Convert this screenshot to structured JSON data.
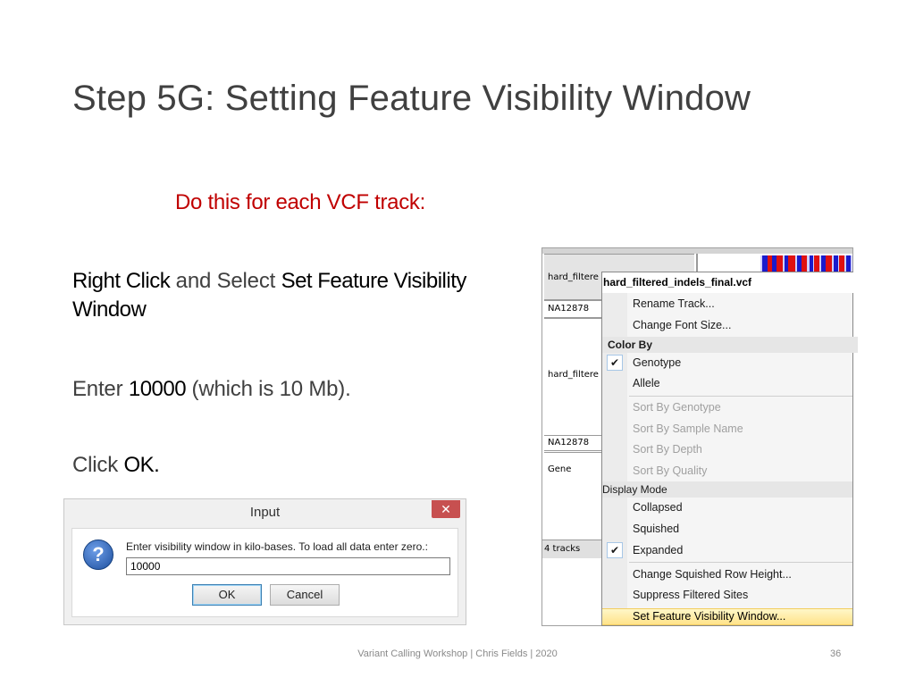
{
  "slide": {
    "title": "Step 5G: Setting Feature Visibility Window",
    "subtitle": "Do this for each VCF track:",
    "step1": {
      "em1": "Right Click",
      "mid": " and Select ",
      "em2": "Set Feature Visibility",
      "em3": "Window"
    },
    "step2": {
      "pre": "Enter ",
      "em": "10000",
      "post": " (which is 10 Mb)."
    },
    "step3": {
      "pre": "Click ",
      "em": "OK."
    },
    "footer": "Variant Calling Workshop | Chris Fields | 2020",
    "page_number": "36"
  },
  "dialog": {
    "title": "Input",
    "close": "✕",
    "icon": "question-icon",
    "prompt": "Enter visibility window in kilo-bases.  To load all data enter zero.:",
    "value": "10000",
    "ok_label": "OK",
    "cancel_label": "Cancel"
  },
  "igv": {
    "tracks": [
      "hard_filtere",
      "NA12878",
      "hard_filtere",
      "NA12878",
      "Gene",
      "4 tracks"
    ],
    "variant_colors": [
      "#1a1acc",
      "#e01010",
      "#ffffff"
    ]
  },
  "menu": {
    "header": "hard_filtered_indels_final.vcf",
    "rename": "Rename Track...",
    "font_size": "Change Font Size...",
    "color_by": "Color By",
    "genotype": "Genotype",
    "allele": "Allele",
    "sort_genotype": "Sort By Genotype",
    "sort_sample": "Sort By Sample Name",
    "sort_depth": "Sort By Depth",
    "sort_quality": "Sort By Quality",
    "display_mode": "Display Mode",
    "collapsed": "Collapsed",
    "squished": "Squished",
    "expanded": "Expanded",
    "squished_height": "Change Squished Row Height...",
    "suppress": "Suppress Filtered Sites",
    "set_visibility": "Set Feature Visibility Window...",
    "check": "✔"
  }
}
